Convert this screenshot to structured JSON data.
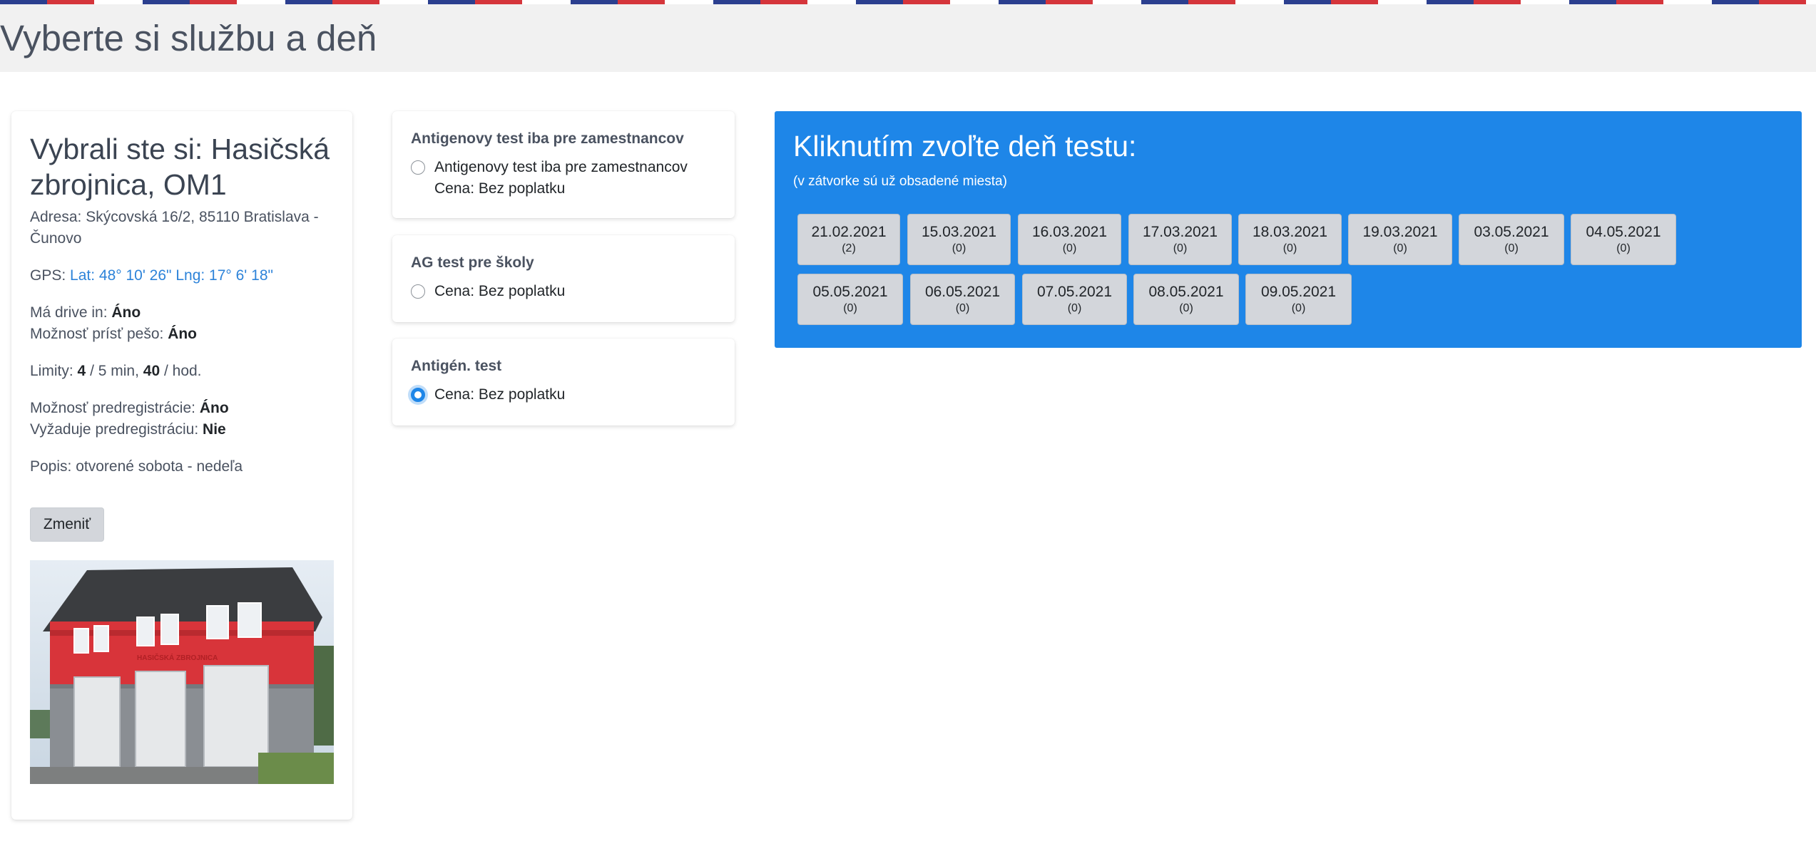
{
  "page": {
    "title": "Vyberte si službu a deň"
  },
  "location": {
    "title": "Vybrali ste si: Hasičská zbrojnica, OM1",
    "address_label": "Adresa:",
    "address_line1": "Skýcovská 16/2, 85110 Bratislava -",
    "address_line2": "Čunovo",
    "gps_label": "GPS:",
    "gps_value": "Lat: 48° 10' 26\" Lng: 17° 6' 18\"",
    "drive_in_label": "Má drive in:",
    "drive_in_value": "Áno",
    "walk_label": "Možnosť prísť pešo:",
    "walk_value": "Áno",
    "limits_label": "Limity:",
    "limits_a": "4",
    "limits_mid": "/ 5 min,",
    "limits_b": "40",
    "limits_end": "/ hod.",
    "prereg_label": "Možnosť predregistrácie:",
    "prereg_value": "Áno",
    "prereg_req_label": "Vyžaduje predregistráciu:",
    "prereg_req_value": "Nie",
    "desc_label": "Popis:",
    "desc_value": "otvorené sobota - nedeľa",
    "change_button": "Zmeniť",
    "photo_sign": "HASIČSKÁ ZBROJNICA"
  },
  "services": [
    {
      "title": "Antigenovy test iba pre zamestnancov",
      "option_line1": "Antigenovy test iba pre zamestnancov",
      "option_line2": "Cena: Bez poplatku",
      "selected": false
    },
    {
      "title": "AG test pre školy",
      "option_line1": "Cena: Bez poplatku",
      "selected": false
    },
    {
      "title": "Antigén. test",
      "option_line1": "Cena: Bez poplatku",
      "selected": true
    }
  ],
  "days_panel": {
    "title": "Kliknutím zvoľte deň testu:",
    "subtitle": "(v zátvorke sú už obsadené miesta)",
    "background": "#1e86e8",
    "days": [
      {
        "date": "21.02.2021",
        "count": "(2)"
      },
      {
        "date": "15.03.2021",
        "count": "(0)"
      },
      {
        "date": "16.03.2021",
        "count": "(0)"
      },
      {
        "date": "17.03.2021",
        "count": "(0)"
      },
      {
        "date": "18.03.2021",
        "count": "(0)"
      },
      {
        "date": "19.03.2021",
        "count": "(0)"
      },
      {
        "date": "03.05.2021",
        "count": "(0)"
      },
      {
        "date": "04.05.2021",
        "count": "(0)"
      },
      {
        "date": "05.05.2021",
        "count": "(0)"
      },
      {
        "date": "06.05.2021",
        "count": "(0)"
      },
      {
        "date": "07.05.2021",
        "count": "(0)"
      },
      {
        "date": "08.05.2021",
        "count": "(0)"
      },
      {
        "date": "09.05.2021",
        "count": "(0)"
      }
    ]
  }
}
